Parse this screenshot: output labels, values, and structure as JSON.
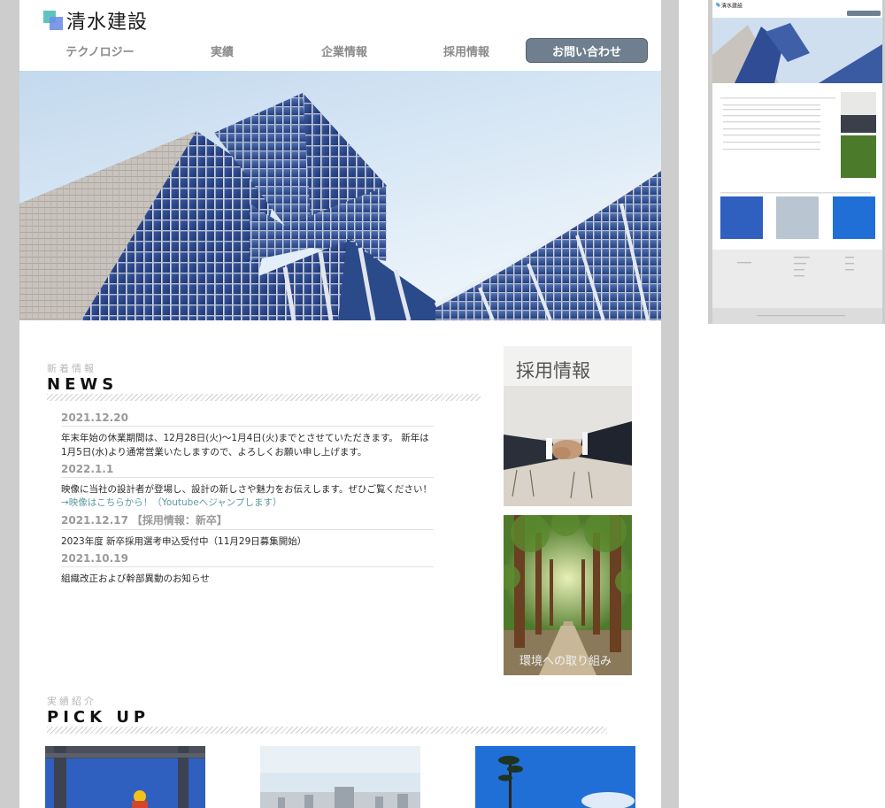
{
  "site": {
    "logo_text": "清水建設"
  },
  "nav": {
    "items": [
      "テクノロジー",
      "実績",
      "企業情報",
      "採用情報"
    ],
    "cta": "お問い合わせ"
  },
  "news": {
    "subtitle": "新着情報",
    "title": "NEWS",
    "items": [
      {
        "date": "2021.12.20",
        "tag": "",
        "body": "年末年始の休業期間は、12月28日(火)〜1月4日(火)までとさせていただきます。 新年は1月5日(水)より通常営業いたしますので、よろしくお願い申し上げます。",
        "link": ""
      },
      {
        "date": "2022.1.1",
        "tag": "",
        "body": "映像に当社の設計者が登場し、設計の新しさや魅力をお伝えします。ぜひご覧ください！",
        "link": "→映像はこちらから！（Youtubeへジャンプします）"
      },
      {
        "date": "2021.12.17",
        "tag": "【採用情報：新卒】",
        "body": "2023年度 新卒採用選考申込受付中（11月29日募集開始）",
        "link": ""
      },
      {
        "date": "2021.10.19",
        "tag": "",
        "body": "組織改正および幹部異動のお知らせ",
        "link": ""
      }
    ]
  },
  "banners": {
    "recruit": "採用情報",
    "environment": "環境への取り組み"
  },
  "pickup": {
    "subtitle": "実績紹介",
    "title": "PICK UP"
  },
  "colors": {
    "cta_bg": "#6f7f8f",
    "link": "#5c9aa3",
    "logo_teal": "#5fc4c1",
    "logo_blue": "#6f8fe6"
  }
}
